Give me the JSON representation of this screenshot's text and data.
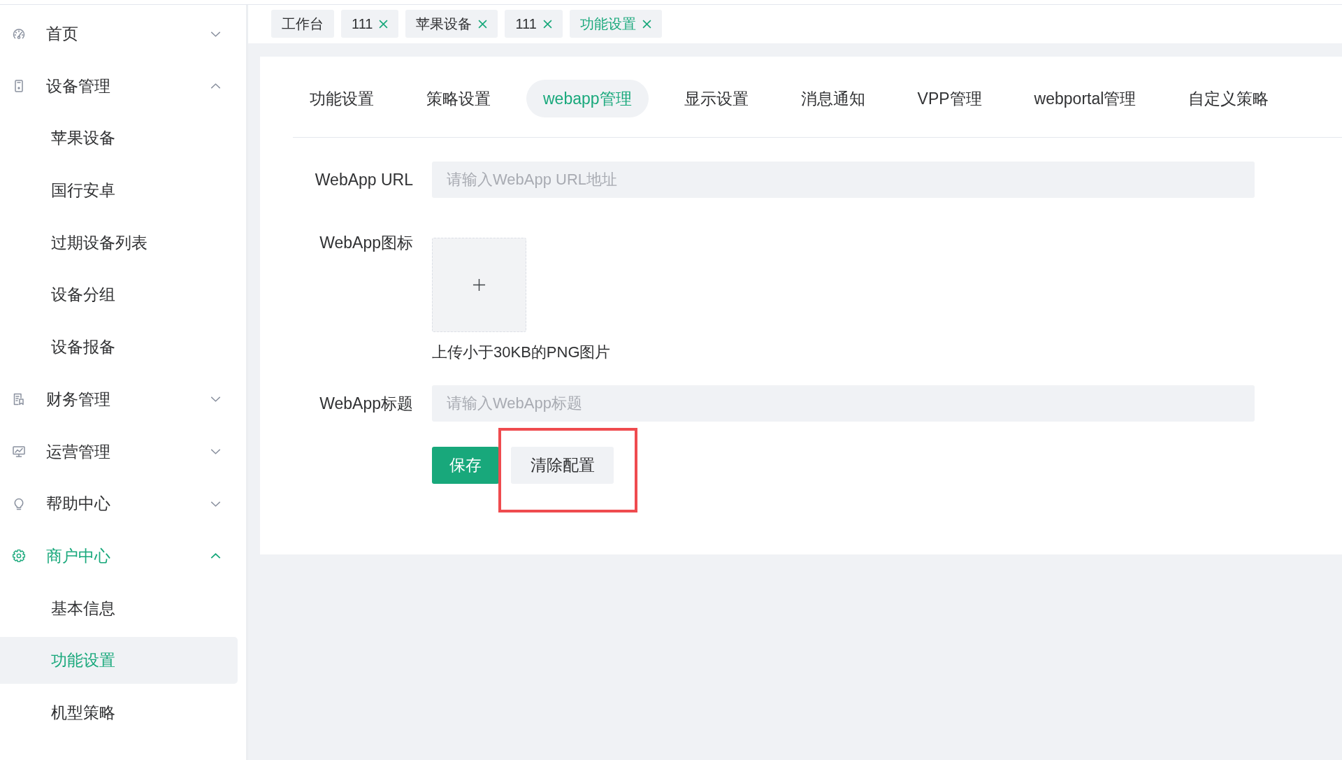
{
  "sidebar": {
    "items": [
      {
        "label": "首页",
        "selected": false,
        "expanded": false
      },
      {
        "label": "设备管理",
        "selected": false,
        "expanded": true,
        "children": [
          {
            "label": "苹果设备",
            "selected": false
          },
          {
            "label": "国行安卓",
            "selected": false
          },
          {
            "label": "过期设备列表",
            "selected": false
          },
          {
            "label": "设备分组",
            "selected": false
          },
          {
            "label": "设备报备",
            "selected": false
          }
        ]
      },
      {
        "label": "财务管理",
        "selected": false,
        "expanded": false
      },
      {
        "label": "运营管理",
        "selected": false,
        "expanded": false
      },
      {
        "label": "帮助中心",
        "selected": false,
        "expanded": false
      },
      {
        "label": "商户中心",
        "selected": true,
        "expanded": true,
        "children": [
          {
            "label": "基本信息",
            "selected": false
          },
          {
            "label": "功能设置",
            "selected": true
          },
          {
            "label": "机型策略",
            "selected": false
          }
        ]
      }
    ]
  },
  "tags": [
    {
      "label": "工作台",
      "closable": false,
      "selected": false
    },
    {
      "label": "111",
      "closable": true,
      "selected": false
    },
    {
      "label": "苹果设备",
      "closable": true,
      "selected": false
    },
    {
      "label": "111",
      "closable": true,
      "selected": false
    },
    {
      "label": "功能设置",
      "closable": true,
      "selected": true
    }
  ],
  "tabs": [
    {
      "label": "功能设置",
      "selected": false
    },
    {
      "label": "策略设置",
      "selected": false
    },
    {
      "label": "webapp管理",
      "selected": true
    },
    {
      "label": "显示设置",
      "selected": false
    },
    {
      "label": "消息通知",
      "selected": false
    },
    {
      "label": "VPP管理",
      "selected": false
    },
    {
      "label": "webportal管理",
      "selected": false
    },
    {
      "label": "自定义策略",
      "selected": false
    }
  ],
  "form": {
    "fields": [
      {
        "kind": "text",
        "label": "WebApp URL",
        "placeholder": "请输入WebApp URL地址"
      },
      {
        "kind": "upload",
        "label": "WebApp图标",
        "hint": "上传小于30KB的PNG图片"
      },
      {
        "kind": "text",
        "label": "WebApp标题",
        "placeholder": "请输入WebApp标题"
      }
    ],
    "buttons": [
      {
        "label": "保存",
        "kind": "primary",
        "highlighted": false
      },
      {
        "label": "清除配置",
        "kind": "default",
        "highlighted": true
      }
    ]
  }
}
